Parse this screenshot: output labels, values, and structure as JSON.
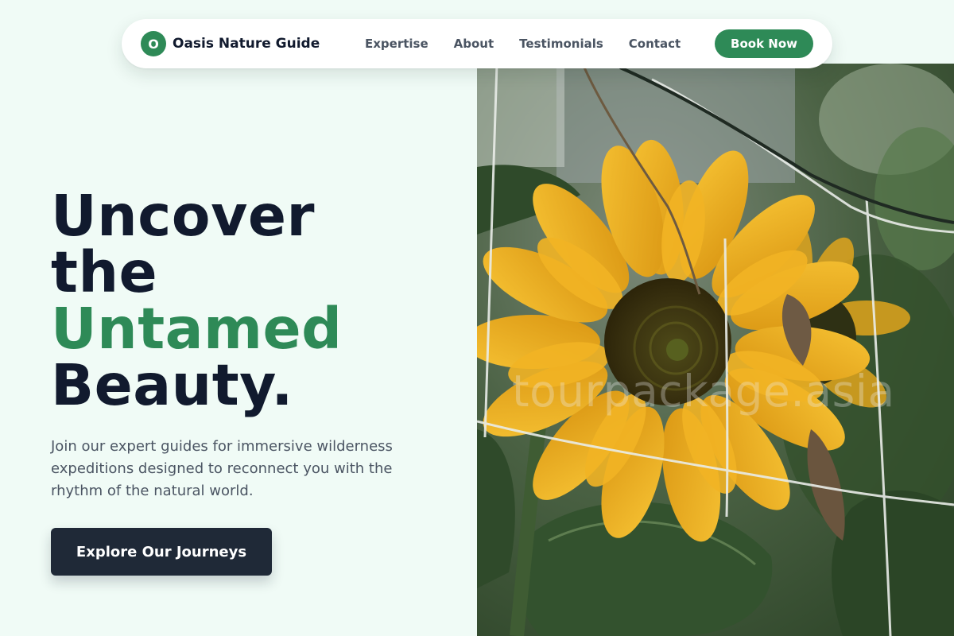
{
  "nav": {
    "brand_initial": "O",
    "brand_name": "Oasis Nature Guide",
    "links": [
      "Expertise",
      "About",
      "Testimonials",
      "Contact"
    ],
    "cta_label": "Book Now"
  },
  "hero": {
    "title_lines": [
      "Uncover",
      "the",
      "Untamed",
      "Beauty."
    ],
    "accent_line": "Untamed",
    "subtitle": "Join our expert guides for immersive wilderness expeditions designed to reconnect you with the rhythm of the natural world.",
    "cta_label": "Explore Our Journeys"
  },
  "image": {
    "subject": "sunflower-photo",
    "watermark": "tourpackage.asia"
  },
  "colors": {
    "background": "#f0fbf6",
    "accent_green": "#2e8a57",
    "heading_navy": "#111a2e",
    "body_gray": "#4b5563",
    "cta_dark": "#1f2937"
  }
}
